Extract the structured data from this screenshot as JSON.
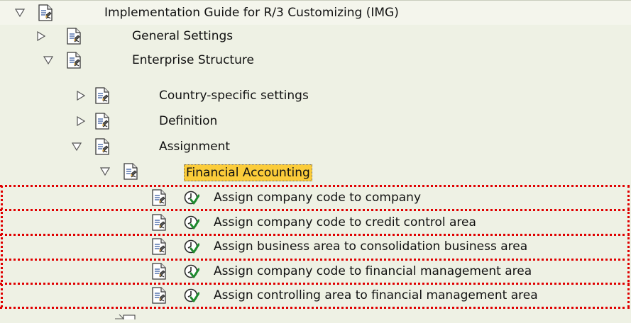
{
  "tree": {
    "root": {
      "label": "Implementation Guide for R/3 Customizing (IMG)"
    },
    "general_settings": {
      "label": "General Settings"
    },
    "enterprise_structure": {
      "label": "Enterprise Structure"
    },
    "country_specific": {
      "label": "Country-specific settings"
    },
    "definition": {
      "label": "Definition"
    },
    "assignment": {
      "label": "Assignment"
    },
    "financial_accounting": {
      "label": "Financial Accounting"
    },
    "activities": [
      {
        "label": "Assign company code to company"
      },
      {
        "label": "Assign company code to credit control area"
      },
      {
        "label": "Assign business area to consolidation business area"
      },
      {
        "label": "Assign company code to financial management area"
      },
      {
        "label": "Assign controlling area to financial management area"
      }
    ]
  },
  "colors": {
    "background": "#eef1e4",
    "selection": "#fbcc3a",
    "highlight_border": "#e00000"
  },
  "icons": {
    "expanded": "triangle-down-icon",
    "collapsed": "triangle-right-icon",
    "document": "document-icon",
    "activity": "clock-check-icon"
  }
}
